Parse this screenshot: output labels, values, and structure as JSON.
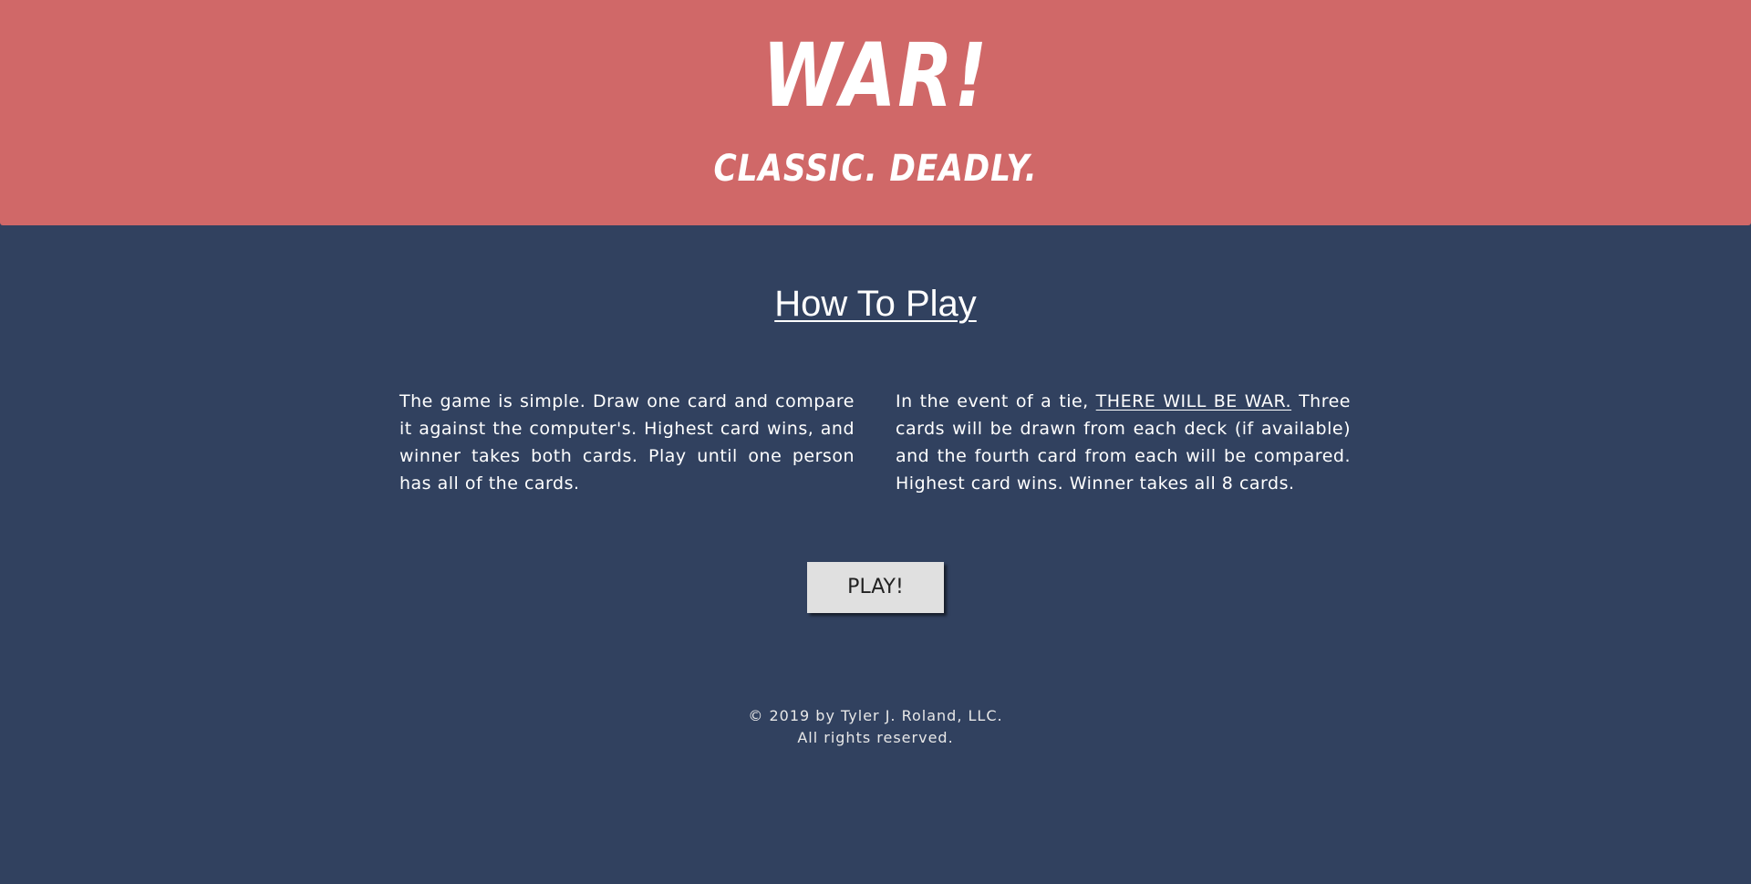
{
  "header": {
    "logo_text": "WAR!",
    "tagline": "CLASSIC. DEADLY."
  },
  "how_to_play": {
    "title": "How To Play",
    "left_rule": "The game is simple. Draw one card and compare it against the computer's. Highest card wins, and winner takes both cards. Play until one person has all of the cards.",
    "right_rule_prefix": "In the event of a tie, ",
    "right_rule_emphasis": "THERE WILL BE WAR.",
    "right_rule_suffix": " Three cards will be drawn from each deck (if available) and the fourth card from each will be compared. Highest card wins. Winner takes all 8 cards."
  },
  "play_button_label": "PLAY!",
  "footer": {
    "copyright": "© 2019 by Tyler J. Roland, LLC.",
    "rights": "All rights reserved."
  },
  "colors": {
    "header_bg": "#d06868",
    "page_bg": "#31415f",
    "button_bg": "#e0e0e0"
  }
}
